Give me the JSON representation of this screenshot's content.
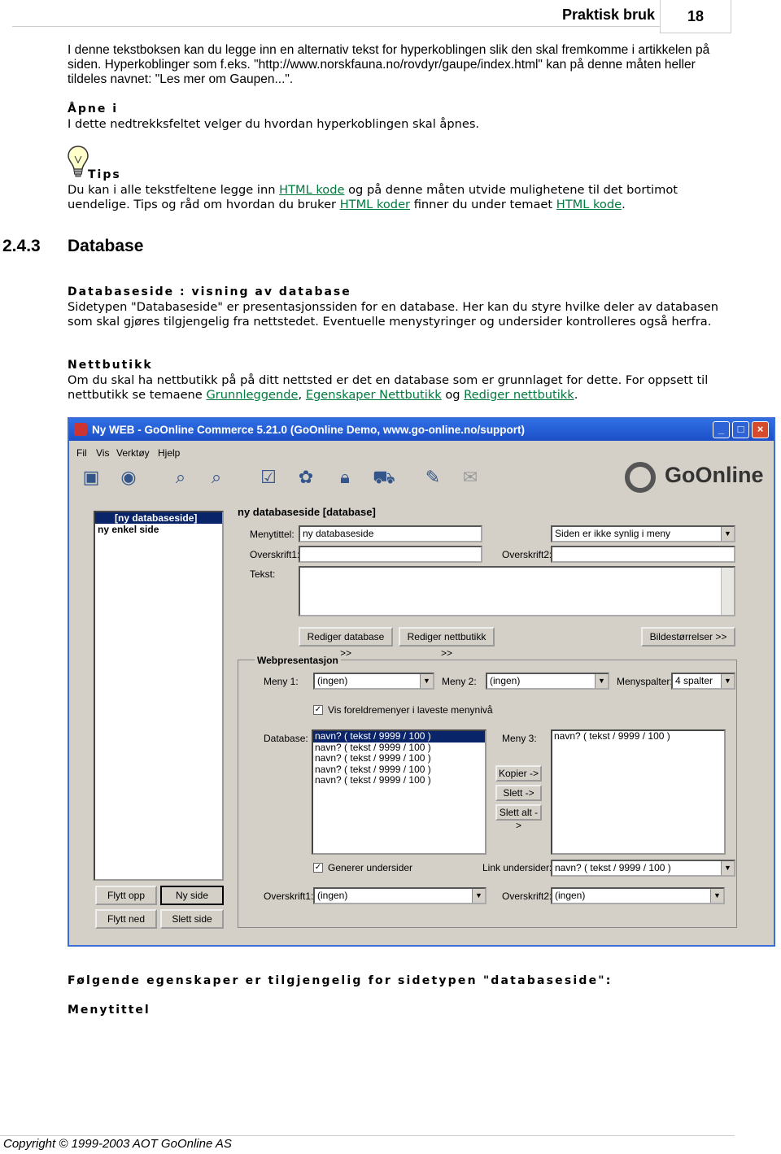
{
  "header": {
    "section": "Praktisk bruk",
    "page_number": "18"
  },
  "intro": {
    "para1": "I denne tekstboksen kan du legge inn en alternativ tekst for hyperkoblingen slik den skal fremkomme i artikkelen på siden. Hyperkoblinger som f.eks. \"http://www.norskfauna.no/rovdyr/gaupe/index.html\" kan på denne måten heller tildeles navnet: \"Les mer om Gaupen...\".",
    "apne_label": "Åpne i",
    "apne_text": "I dette nedtrekksfeltet velger du hvordan hyperkoblingen skal åpnes."
  },
  "tips": {
    "label": "Tips",
    "t1": "Du kan i alle tekstfeltene legge inn ",
    "l1": "HTML kode",
    "t2": " og på denne måten utvide mulighetene til det bortimot uendelige. Tips og råd om hvordan du bruker ",
    "l2": "HTML koder",
    "t3": " finner du under temaet ",
    "l3": "HTML kode",
    "t4": "."
  },
  "section": {
    "number": "2.4.3",
    "title": "Database"
  },
  "databaseside": {
    "label": "Databaseside : visning av database",
    "text": "Sidetypen \"Databaseside\" er presentasjonssiden for en database. Her kan du styre hvilke deler av databasen som skal gjøres tilgjengelig fra nettstedet. Eventuelle menystyringer og undersider kontrolleres også herfra."
  },
  "nettbutikk": {
    "label": "Nettbutikk",
    "t1": "Om du skal ha nettbutikk på på ditt nettsted er det en database som er grunnlaget for dette. For oppsett til nettbutikk se temaene ",
    "l1": "Grunnleggende",
    "t2": ", ",
    "l2": "Egenskaper Nettbutikk",
    "t3": " og ",
    "l3": "Rediger nettbutikk",
    "t4": "."
  },
  "app": {
    "title": "Ny WEB - GoOnline Commerce 5.21.0 (GoOnline Demo, www.go-online.no/support)",
    "menu": [
      "Fil",
      "Vis",
      "Verktøy",
      "Hjelp"
    ],
    "logo": "GoOnline",
    "tree": [
      "[ny databaseside]",
      "ny enkel side"
    ],
    "page_header": "ny databaseside  [database]",
    "menytittel_label": "Menytittel:",
    "menytittel_value": "ny databaseside",
    "visibility_value": "Siden er ikke synlig i meny",
    "overskrift1_label": "Overskrift1:",
    "overskrift2_label": "Overskrift2:",
    "tekst_label": "Tekst:",
    "btn_rediger_db": "Rediger database >>",
    "btn_rediger_nb": "Rediger nettbutikk >>",
    "btn_bilde": "Bildestørrelser >>",
    "web_group": "Webpresentasjon",
    "meny1_label": "Meny 1:",
    "meny1_value": "(ingen)",
    "meny2_label": "Meny 2:",
    "meny2_value": "(ingen)",
    "menyspalter_label": "Menyspalter:",
    "menyspalter_value": "4 spalter",
    "vis_check": "Vis foreldremenyer i laveste menynivå",
    "database_label": "Database:",
    "database_items": [
      "navn?  ( tekst / 9999 / 100 )",
      "navn?  ( tekst / 9999 / 100 )",
      "navn?  ( tekst / 9999 / 100 )",
      "navn?  ( tekst / 9999 / 100 )",
      "navn?  ( tekst / 9999 / 100 )"
    ],
    "meny3_label": "Meny 3:",
    "meny3_items": [
      "navn?  ( tekst / 9999 / 100 )"
    ],
    "btn_kopier": "Kopier ->",
    "btn_slett": "Slett ->",
    "btn_slett_alt": "Slett alt ->",
    "generer_check": "Generer undersider",
    "link_label": "Link undersider:",
    "link_value": "navn?  ( tekst / 9999 / 100 )",
    "ov1_label": "Overskrift1:",
    "ov1_value": "(ingen)",
    "ov2_label": "Overskrift2:",
    "ov2_value": "(ingen)",
    "btn_flytt_opp": "Flytt opp",
    "btn_ny_side": "Ny side",
    "btn_flytt_ned": "Flytt ned",
    "btn_slett_side": "Slett side"
  },
  "following": "Følgende egenskaper er tilgjengelig for sidetypen \"databaseside\":",
  "menytittel_heading": "Menytittel",
  "footer": "Copyright © 1999-2003 AOT GoOnline AS"
}
